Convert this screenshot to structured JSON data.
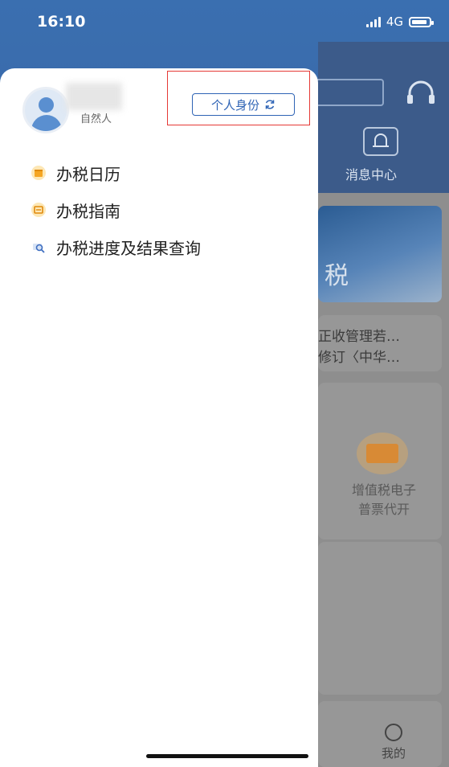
{
  "status_bar": {
    "time": "16:10",
    "network": "4G"
  },
  "background": {
    "header": {
      "message_center_label": "消息中心"
    },
    "banner": {
      "text": "税"
    },
    "news": {
      "line1": "正收管理若…",
      "line2": "修订〈中华…"
    },
    "services": [
      {
        "label_line1": "增值税电子",
        "label_line2": "普票代开"
      }
    ],
    "tabbar": {
      "mine_label": "我的"
    }
  },
  "drawer": {
    "user": {
      "type_label": "自然人"
    },
    "identity_button": {
      "label": "个人身份"
    },
    "menu": [
      {
        "label": "办税日历",
        "icon": "calendar-icon"
      },
      {
        "label": "办税指南",
        "icon": "guide-icon"
      },
      {
        "label": "办税进度及结果查询",
        "icon": "progress-query-icon"
      }
    ]
  },
  "colors": {
    "primary": "#2f64b5",
    "header_blue": "#3a6fb0",
    "highlight_red": "#e53935",
    "icon_orange": "#f5a623"
  }
}
